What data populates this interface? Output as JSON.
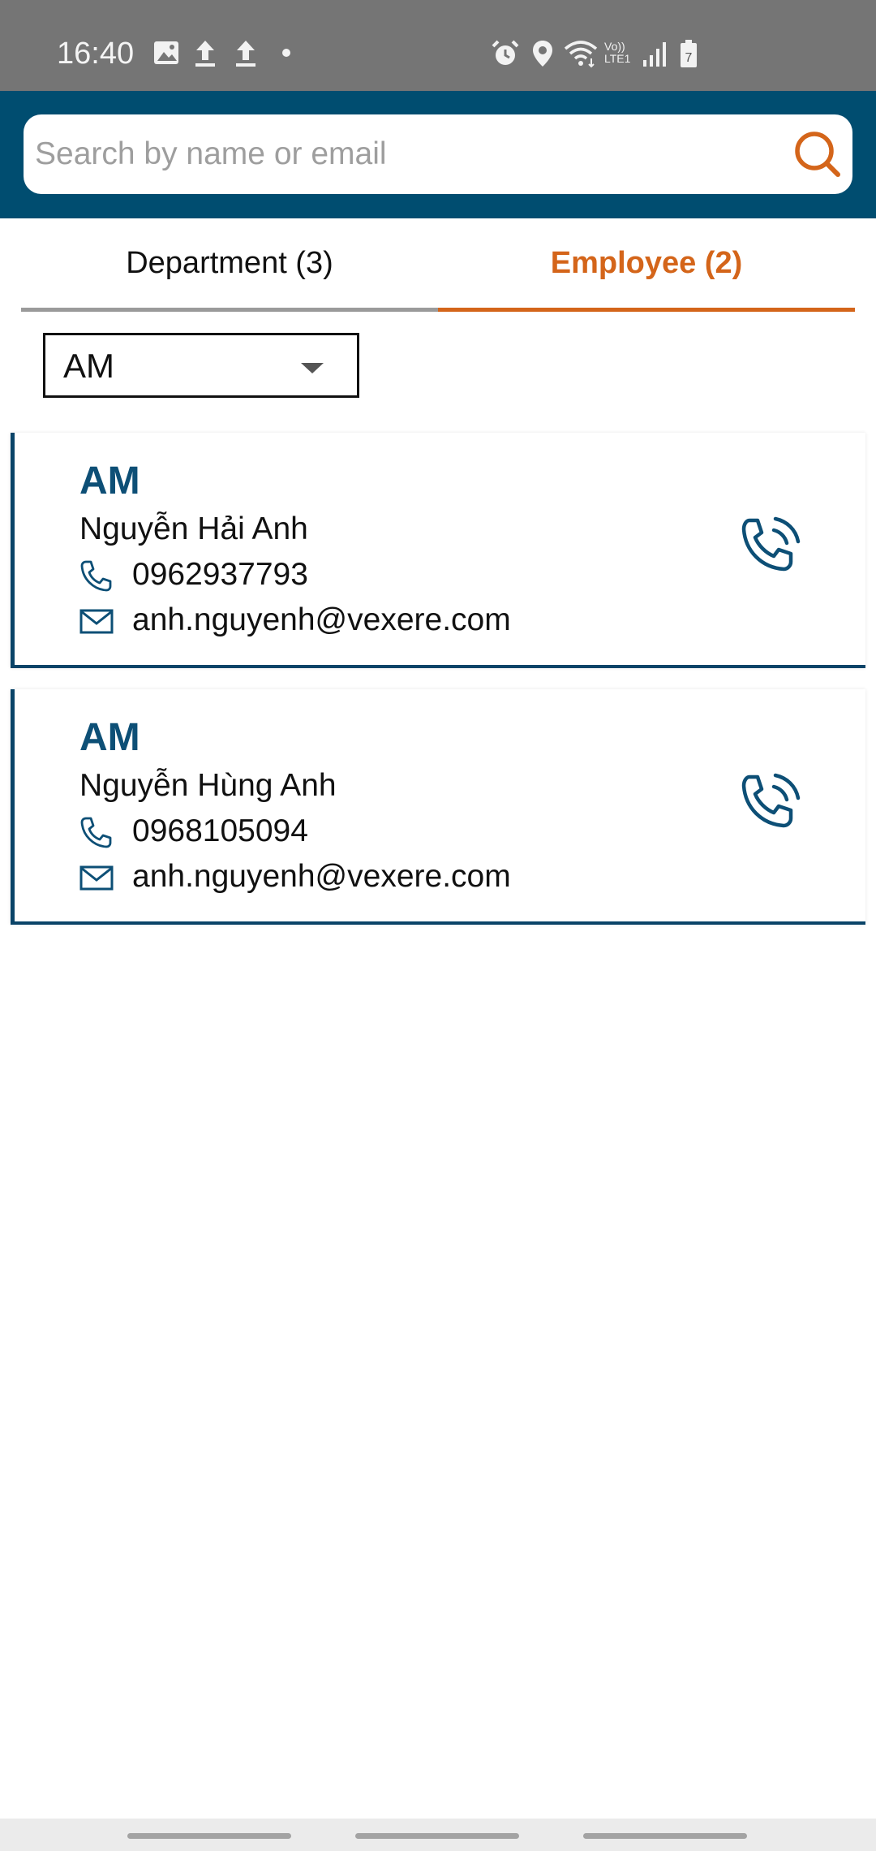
{
  "status_bar": {
    "time": "16:40",
    "icons": [
      "image-icon",
      "upload-icon",
      "upload-icon",
      "dot-icon",
      "alarm-icon",
      "location-icon",
      "wifi-icon",
      "volte-icon",
      "signal-icon",
      "battery-icon"
    ],
    "volte_label_top": "Vo))",
    "volte_label_bottom": "LTE1",
    "battery_level": "7",
    "background": "#757575"
  },
  "header": {
    "background": "#004d70",
    "search": {
      "placeholder": "Search by name or email",
      "value": "",
      "icon": "search-icon",
      "icon_color": "#d4651a"
    }
  },
  "tabs": [
    {
      "label": "Department (3)",
      "active": false
    },
    {
      "label": "Employee (2)",
      "active": true,
      "color": "#d4651a"
    }
  ],
  "filter": {
    "selected": "AM"
  },
  "employees": [
    {
      "department": "AM",
      "name": "Nguyễn Hải Anh",
      "phone": "0962937793",
      "email": "anh.nguyenh@vexere.com"
    },
    {
      "department": "AM",
      "name": "Nguyễn Hùng Anh",
      "phone": "0968105094",
      "email": "anh.nguyenh@vexere.com"
    }
  ],
  "colors": {
    "primary": "#0d4f76",
    "accent": "#d4651a"
  }
}
